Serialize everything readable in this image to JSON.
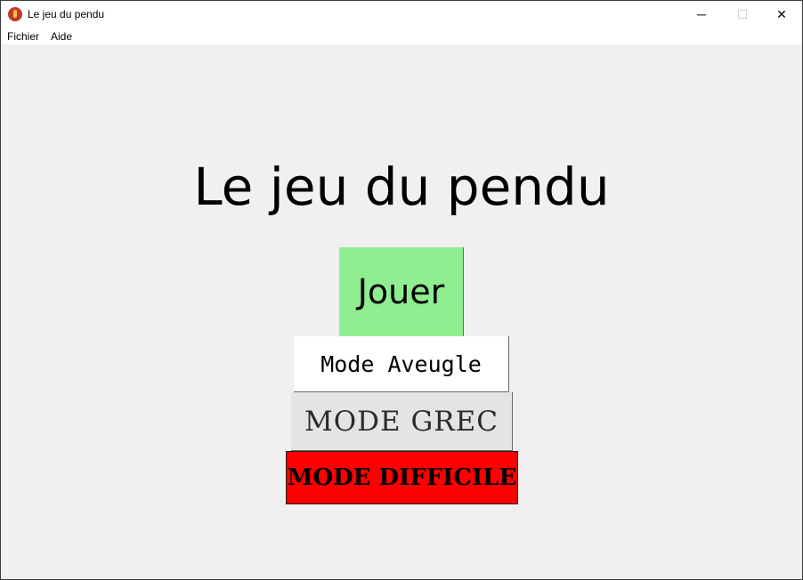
{
  "window": {
    "title": "Le jeu du pendu",
    "icon": "flame-icon",
    "controls": {
      "minimize": "─",
      "maximize": "☐",
      "close": "✕"
    }
  },
  "menu": {
    "items": [
      "Fichier",
      "Aide"
    ]
  },
  "main": {
    "heading": "Le jeu du pendu",
    "buttons": {
      "jouer": "Jouer",
      "aveugle": "Mode Aveugle",
      "grec": "MODE GREC",
      "difficile": "MODE DIFFICILE"
    }
  },
  "colors": {
    "jouer_bg": "#90ee90",
    "aveugle_bg": "#ffffff",
    "grec_bg": "#e4e4e4",
    "difficile_bg": "#ff0000",
    "content_bg": "#f0f0f0"
  }
}
